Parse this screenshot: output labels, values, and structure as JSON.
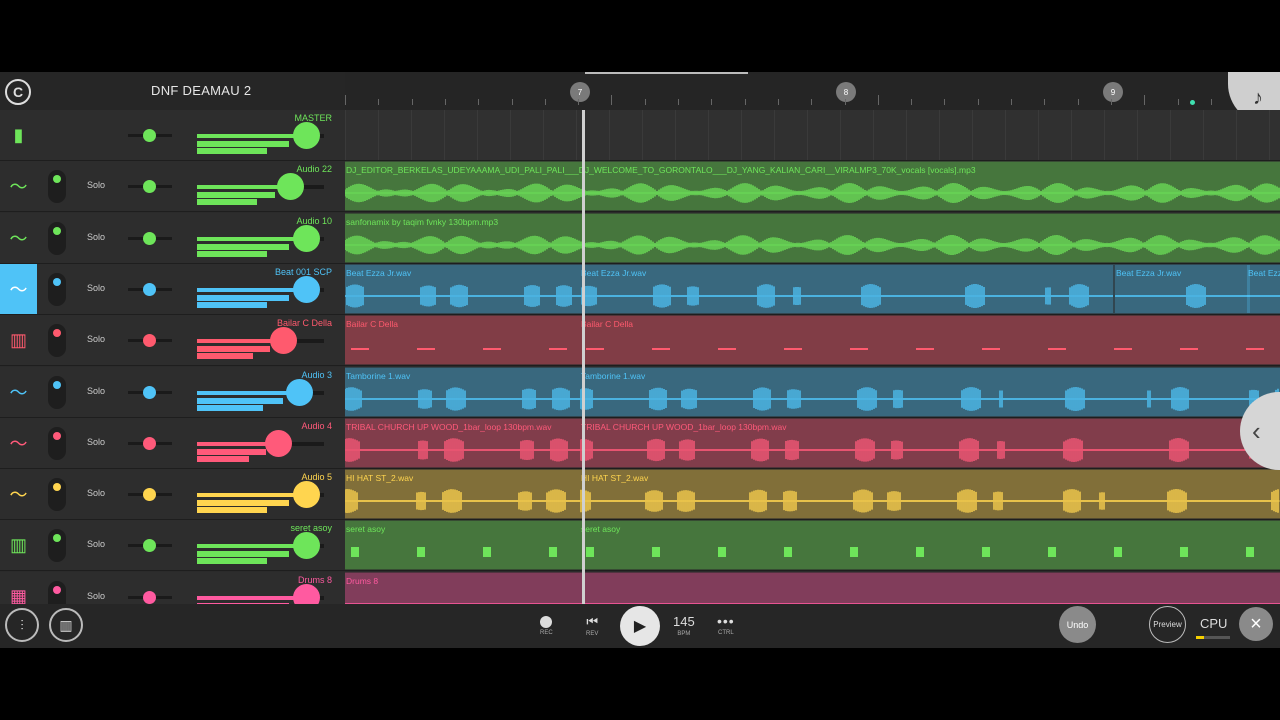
{
  "project_title": "DNF DEAMAU 2",
  "ruler_markers": [
    "7",
    "8",
    "9"
  ],
  "tracks": [
    {
      "name": "MASTER",
      "color": "#6ee55a",
      "type": "master",
      "icon": "mixer-bars-icon",
      "vol": 0.86,
      "clips": []
    },
    {
      "name": "Audio 22",
      "color": "#6ee55a",
      "solo": "Solo",
      "icon": "waveform-icon",
      "vol": 0.73,
      "clips": [
        {
          "label": "DJ_EDITOR_BERKELAS_UDEYAAAMA_UDI_PALI_PALI___DJ_WELCOME_TO_GORONTALO___DJ_YANG_KALIAN_CARI__VIRALMP3_70K_vocals [vocals].mp3"
        }
      ]
    },
    {
      "name": "Audio 10",
      "color": "#6ee55a",
      "solo": "Solo",
      "icon": "waveform-icon",
      "vol": 0.86,
      "clips": [
        {
          "label": "sanfonamix by taqim fvnky 130bpm.mp3"
        }
      ]
    },
    {
      "name": "Beat 001 SCP",
      "color": "#4fc3f7",
      "solo": "Solo",
      "icon": "waveform-icon",
      "vol": 0.86,
      "clips": [
        {
          "label": "Beat Ezza Jr.wav"
        },
        {
          "label": "Beat Ezza Jr.wav"
        },
        {
          "label": "Beat Ezza Jr.wav"
        },
        {
          "label": "Beat Ezz"
        }
      ]
    },
    {
      "name": "Bailar C Della",
      "color": "#ff5a6e",
      "solo": "Solo",
      "icon": "piano-icon",
      "vol": 0.68,
      "clips": [
        {
          "label": "Bailar C Della"
        },
        {
          "label": "Bailar C Della"
        }
      ]
    },
    {
      "name": "Audio 3",
      "color": "#4fc3f7",
      "solo": "Solo",
      "icon": "waveform-icon",
      "vol": 0.8,
      "clips": [
        {
          "label": "Tamborine 1.wav"
        },
        {
          "label": "Tamborine 1.wav"
        }
      ]
    },
    {
      "name": "Audio 4",
      "color": "#ff5a7a",
      "solo": "Solo",
      "icon": "waveform-icon",
      "vol": 0.64,
      "clips": [
        {
          "label": "TRIBAL CHURCH UP WOOD_1bar_loop 130bpm.wav"
        },
        {
          "label": "TRIBAL CHURCH UP WOOD_1bar_loop 130bpm.wav"
        }
      ]
    },
    {
      "name": "Audio 5",
      "color": "#ffd54f",
      "solo": "Solo",
      "icon": "waveform-icon",
      "vol": 0.86,
      "clips": [
        {
          "label": "HI HAT ST_2.wav"
        },
        {
          "label": "HI HAT ST_2.wav"
        }
      ]
    },
    {
      "name": "seret asoy",
      "color": "#6ee55a",
      "solo": "Solo",
      "icon": "piano-icon",
      "vol": 0.86,
      "clips": [
        {
          "label": "seret asoy"
        },
        {
          "label": "seret asoy"
        }
      ]
    },
    {
      "name": "Drums 8",
      "color": "#ff5aa0",
      "solo": "Solo",
      "icon": "drum-pads-icon",
      "vol": 0.86,
      "clips": [
        {
          "label": "Drums 8"
        }
      ]
    }
  ],
  "transport": {
    "rec": "REC",
    "rev": "REV",
    "bpm_value": "145",
    "bpm_label": "BPM",
    "ctrl": "CTRL",
    "undo": "Undo",
    "preview": "Preview",
    "cpu": "CPU"
  }
}
